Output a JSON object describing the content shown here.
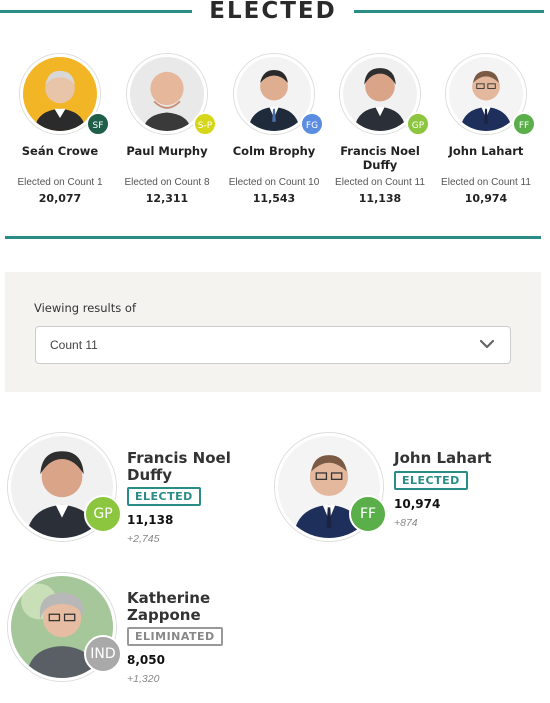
{
  "header": {
    "title": "ELECTED"
  },
  "elected": [
    {
      "name": "Seán Crowe",
      "count_text": "Elected on Count 1",
      "votes": "20,077",
      "party": "SF",
      "party_color": "#1f5f4a"
    },
    {
      "name": "Paul Murphy",
      "count_text": "Elected on Count 8",
      "votes": "12,311",
      "party": "S-P",
      "party_color": "#d6d61a"
    },
    {
      "name": "Colm Brophy",
      "count_text": "Elected on Count 10",
      "votes": "11,543",
      "party": "FG",
      "party_color": "#5a8de0"
    },
    {
      "name": "Francis Noel Duffy",
      "count_text": "Elected on Count 11",
      "votes": "11,138",
      "party": "GP",
      "party_color": "#8cc63f"
    },
    {
      "name": "John Lahart",
      "count_text": "Elected on Count 11",
      "votes": "10,974",
      "party": "FF",
      "party_color": "#5aaf4a"
    }
  ],
  "panel": {
    "label": "Viewing results of",
    "selected": "Count 11"
  },
  "results": [
    {
      "name": "Francis Noel Duffy",
      "status": "ELECTED",
      "votes": "11,138",
      "delta": "+2,745",
      "party": "GP",
      "party_color": "#8cc63f"
    },
    {
      "name": "John Lahart",
      "status": "ELECTED",
      "votes": "10,974",
      "delta": "+874",
      "party": "FF",
      "party_color": "#5aaf4a"
    },
    {
      "name": "Katherine Zappone",
      "status": "ELIMINATED",
      "votes": "8,050",
      "delta": "+1,320",
      "party": "IND",
      "party_color": "#a9a9a9"
    }
  ],
  "colors": {
    "accent": "#2a8c86",
    "panel_bg": "#f4f3ef"
  }
}
